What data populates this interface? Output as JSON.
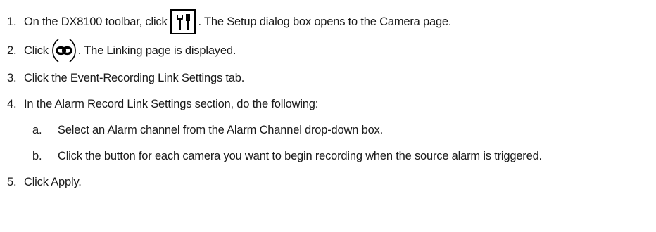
{
  "steps": [
    {
      "number": "1.",
      "text_before": "On the DX8100 toolbar, click",
      "icon": "setup-tools-icon",
      "text_after": ". The Setup dialog box opens to the Camera page."
    },
    {
      "number": "2.",
      "text_before": "Click",
      "icon": "link-chain-icon",
      "text_after": ". The Linking page is displayed."
    },
    {
      "number": "3.",
      "text": "Click the Event-Recording Link Settings tab."
    },
    {
      "number": "4.",
      "text": "In the Alarm Record Link Settings section, do the following:"
    },
    {
      "number": "5.",
      "text": "Click Apply."
    }
  ],
  "substeps": [
    {
      "letter": "a.",
      "text": "Select an Alarm channel from the Alarm Channel drop-down box."
    },
    {
      "letter": "b.",
      "text": "Click the button for each camera you want to begin recording when the source alarm is triggered."
    }
  ]
}
